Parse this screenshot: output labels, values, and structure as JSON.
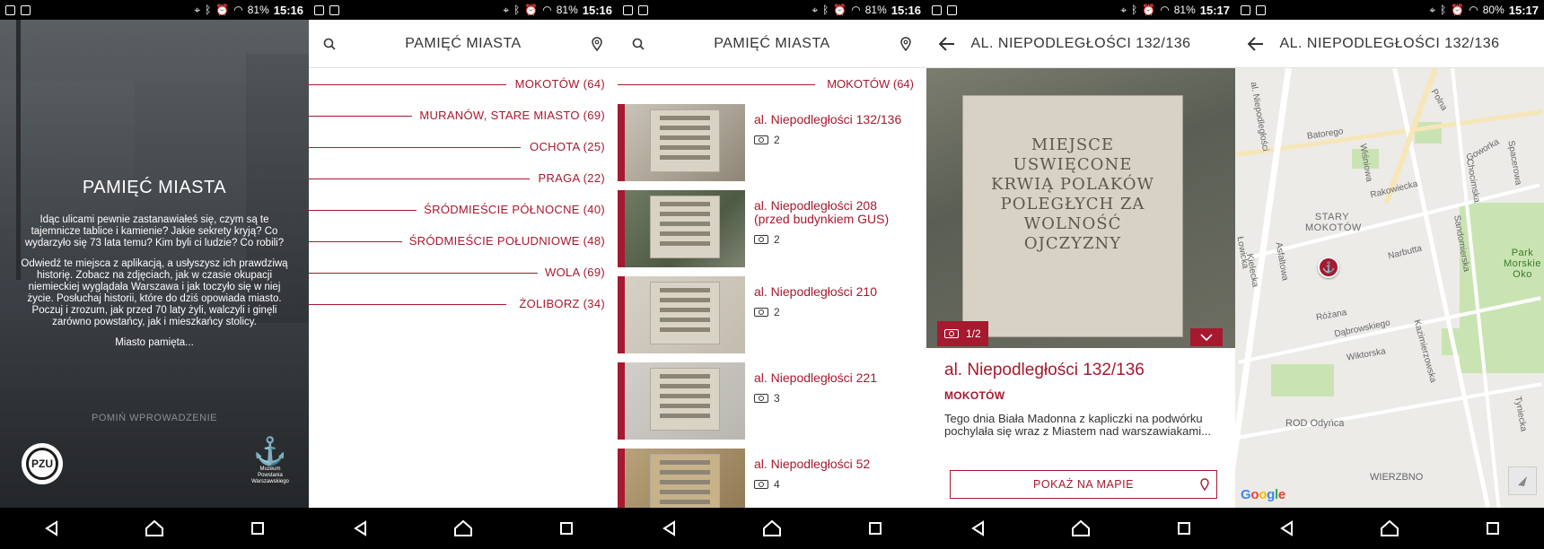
{
  "screens": {
    "intro": {
      "status": {
        "battery": "81%",
        "time": "15:16"
      },
      "title": "PAMIĘĆ MIASTA",
      "paragraph1": "Idąc ulicami pewnie zastanawiałeś się, czym są te tajemnicze tablice i kamienie? Jakie sekrety kryją? Co wydarzyło się 73 lata temu? Kim byli ci ludzie? Co robili?",
      "paragraph2": "Odwiedź te miejsca z aplikacją, a usłyszysz ich prawdziwą historię. Zobacz na zdjęciach, jak w czasie okupacji niemieckiej wyglądała Warszawa i jak toczyło się w niej życie. Posłuchaj historii, które do dziś opowiada miasto. Poczuj i zrozum, jak przed 70 laty żyli, walczyli i ginęli zarówno powstańcy, jak i mieszkańcy stolicy.",
      "paragraph3": "Miasto pamięta...",
      "skip_label": "POMIŃ WPROWADZENIE",
      "sponsor_logo_text": "PZU",
      "museum_logo_text": "Muzeum Powstania Warszawskiego"
    },
    "districts": {
      "status": {
        "battery": "81%",
        "time": "15:16"
      },
      "title": "PAMIĘĆ MIASTA",
      "items": [
        {
          "label": "MOKOTÓW (64)"
        },
        {
          "label": "MURANÓW, STARE MIASTO (69)"
        },
        {
          "label": "OCHOTA (25)"
        },
        {
          "label": "PRAGA (22)"
        },
        {
          "label": "ŚRÓDMIEŚCIE PÓŁNOCNE (40)"
        },
        {
          "label": "ŚRÓDMIEŚCIE POŁUDNIOWE (48)"
        },
        {
          "label": "WOLA (69)"
        },
        {
          "label": "ŻOLIBORZ (34)"
        }
      ]
    },
    "places": {
      "status": {
        "battery": "81%",
        "time": "15:16"
      },
      "title": "PAMIĘĆ MIASTA",
      "section": "MOKOTÓW (64)",
      "items": [
        {
          "name": "al. Niepodległości 132/136",
          "photos": "2"
        },
        {
          "name": "al. Niepodległości 208 (przed budynkiem GUS)",
          "photos": "2"
        },
        {
          "name": "al. Niepodległości 210",
          "photos": "2"
        },
        {
          "name": "al. Niepodległości 221",
          "photos": "3"
        },
        {
          "name": "al. Niepodległości 52",
          "photos": "4"
        }
      ]
    },
    "detail": {
      "status": {
        "battery": "81%",
        "time": "15:17"
      },
      "title": "AL. NIEPODLEGŁOŚCI 132/136",
      "photo_counter": "1/2",
      "stone_text": "MIEJSCE USWIĘCONE KRWIĄ POLAKÓW POLEGŁYCH ZA WOLNOŚĆ OJCZYZNY",
      "card_title": "al. Niepodległości 132/136",
      "card_district": "MOKOTÓW",
      "card_description": "Tego dnia Biała Madonna z kapliczki na podwórku pochylała się wraz z Miastem nad warszawiakami...",
      "map_button": "POKAŻ NA MAPIE"
    },
    "map": {
      "status": {
        "battery": "80%",
        "time": "15:17"
      },
      "title": "AL. NIEPODLEGŁOŚCI 132/136",
      "district_label": "STARY MOKOTÓW",
      "streets": [
        "Wiśniowa",
        "Rakowiecka",
        "Chocimska",
        "Spacerowa",
        "Goworka",
        "Batorego",
        "Narbutta",
        "Sandomierska",
        "Asfaltowa",
        "Kielecka",
        "Łowicka",
        "Różana",
        "Dąbrowskiego",
        "Kazimierzowska",
        "Wiktorska",
        "Tyniecka",
        "Puławska",
        "Polna",
        "al. Niepodległości"
      ],
      "park_label": "Park Morskie Oko",
      "garden_label": "ROD Odyńca",
      "area_label": "WIERZBNO",
      "provider": "Google"
    }
  }
}
